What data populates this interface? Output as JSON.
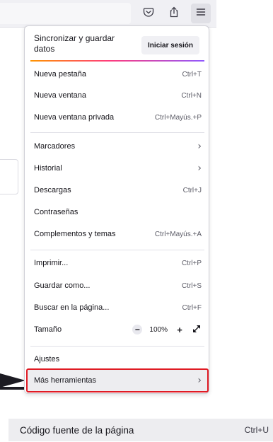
{
  "toolbar": {
    "pocket_icon": "pocket-icon",
    "share_icon": "share-icon",
    "menu_icon": "hamburger-menu-icon"
  },
  "menu": {
    "sync": {
      "text": "Sincronizar y guardar datos",
      "signin_label": "Iniciar sesión"
    },
    "items": [
      {
        "label": "Nueva pestaña",
        "shortcut": "Ctrl+T"
      },
      {
        "label": "Nueva ventana",
        "shortcut": "Ctrl+N"
      },
      {
        "label": "Nueva ventana privada",
        "shortcut": "Ctrl+Mayús.+P"
      },
      {
        "label": "Marcadores",
        "shortcut": "›"
      },
      {
        "label": "Historial",
        "shortcut": "›"
      },
      {
        "label": "Descargas",
        "shortcut": "Ctrl+J"
      },
      {
        "label": "Contraseñas",
        "shortcut": ""
      },
      {
        "label": "Complementos y temas",
        "shortcut": "Ctrl+Mayús.+A"
      },
      {
        "label": "Imprimir...",
        "shortcut": "Ctrl+P"
      },
      {
        "label": "Guardar como...",
        "shortcut": "Ctrl+S"
      },
      {
        "label": "Buscar en la página...",
        "shortcut": "Ctrl+F"
      },
      {
        "label": "Tamaño",
        "shortcut": ""
      },
      {
        "label": "Ajustes",
        "shortcut": ""
      },
      {
        "label": "Más herramientas",
        "shortcut": "›"
      }
    ],
    "zoom": {
      "minus": "−",
      "value": "100%",
      "plus": "+"
    }
  },
  "submenu": {
    "label": "Código fuente de la página",
    "shortcut": "Ctrl+U"
  },
  "colors": {
    "highlight_outline": "#e01b24",
    "accent_start": "#ff9500",
    "accent_end": "#9059ff"
  }
}
